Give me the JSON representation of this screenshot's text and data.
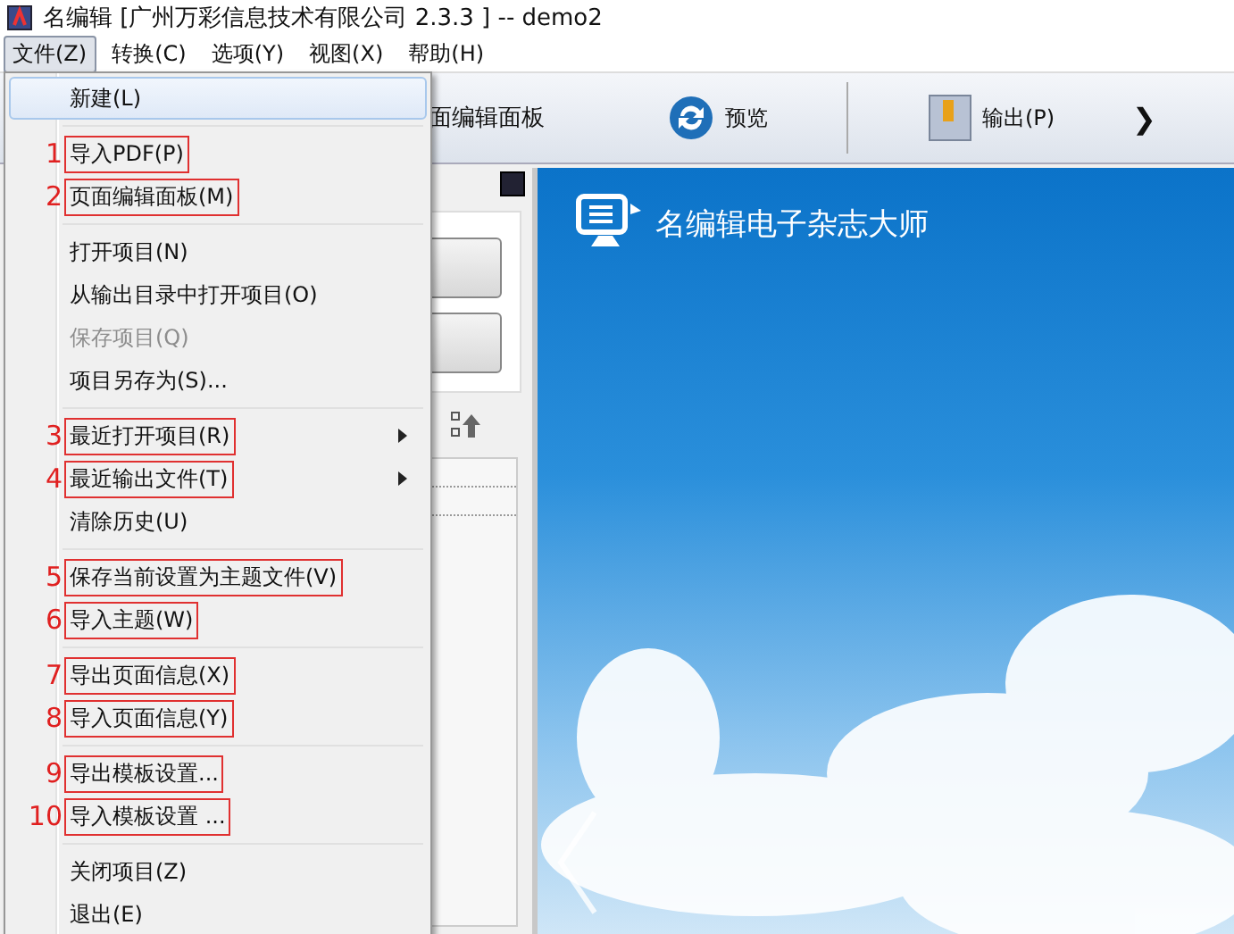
{
  "window": {
    "title": "名编辑 [广州万彩信息技术有限公司 2.3.3 ] -- demo2"
  },
  "menubar": [
    {
      "label": "文件(Z)",
      "selected": true
    },
    {
      "label": "转换(C)",
      "selected": false
    },
    {
      "label": "选项(Y)",
      "selected": false
    },
    {
      "label": "视图(X)",
      "selected": false
    },
    {
      "label": "帮助(H)",
      "selected": false
    }
  ],
  "toolbar": [
    {
      "kind": "text",
      "label": "面编辑面板"
    },
    {
      "kind": "preview",
      "label": "预览"
    },
    {
      "kind": "output",
      "label": "输出(P)"
    },
    {
      "kind": "more",
      "label": "❯"
    }
  ],
  "preview": {
    "brand": "名编辑电子杂志大师"
  },
  "file_menu": [
    {
      "kind": "item",
      "label": "新建(L)",
      "selected": true,
      "disabled": false
    },
    {
      "kind": "separator"
    },
    {
      "kind": "item",
      "label": "导入PDF(P)",
      "annotation": "1",
      "selected": false,
      "disabled": false
    },
    {
      "kind": "item",
      "label": "页面编辑面板(M)",
      "annotation": "2",
      "selected": false,
      "disabled": false
    },
    {
      "kind": "separator"
    },
    {
      "kind": "item",
      "label": "打开项目(N)",
      "selected": false,
      "disabled": false
    },
    {
      "kind": "item",
      "label": "从输出目录中打开项目(O)",
      "selected": false,
      "disabled": false
    },
    {
      "kind": "item",
      "label": "保存项目(Q)",
      "selected": false,
      "disabled": true
    },
    {
      "kind": "item",
      "label": "项目另存为(S)...",
      "selected": false,
      "disabled": false
    },
    {
      "kind": "separator"
    },
    {
      "kind": "submenu",
      "label": "最近打开项目(R)",
      "annotation": "3",
      "selected": false,
      "disabled": false
    },
    {
      "kind": "submenu",
      "label": "最近输出文件(T)",
      "annotation": "4",
      "selected": false,
      "disabled": false
    },
    {
      "kind": "item",
      "label": "清除历史(U)",
      "selected": false,
      "disabled": false
    },
    {
      "kind": "separator"
    },
    {
      "kind": "item",
      "label": "保存当前设置为主题文件(V)",
      "annotation": "5",
      "selected": false,
      "disabled": false
    },
    {
      "kind": "item",
      "label": "导入主题(W)",
      "annotation": "6",
      "selected": false,
      "disabled": false
    },
    {
      "kind": "separator"
    },
    {
      "kind": "item",
      "label": "导出页面信息(X)",
      "annotation": "7",
      "selected": false,
      "disabled": false
    },
    {
      "kind": "item",
      "label": "导入页面信息(Y)",
      "annotation": "8",
      "selected": false,
      "disabled": false
    },
    {
      "kind": "separator"
    },
    {
      "kind": "item",
      "label": "导出模板设置...",
      "annotation": "9",
      "selected": false,
      "disabled": false
    },
    {
      "kind": "item",
      "label": "导入模板设置 ...",
      "annotation": "10",
      "selected": false,
      "disabled": false
    },
    {
      "kind": "separator"
    },
    {
      "kind": "item",
      "label": "关闭项目(Z)",
      "selected": false,
      "disabled": false
    },
    {
      "kind": "item",
      "label": "退出(E)",
      "selected": false,
      "disabled": false
    }
  ]
}
